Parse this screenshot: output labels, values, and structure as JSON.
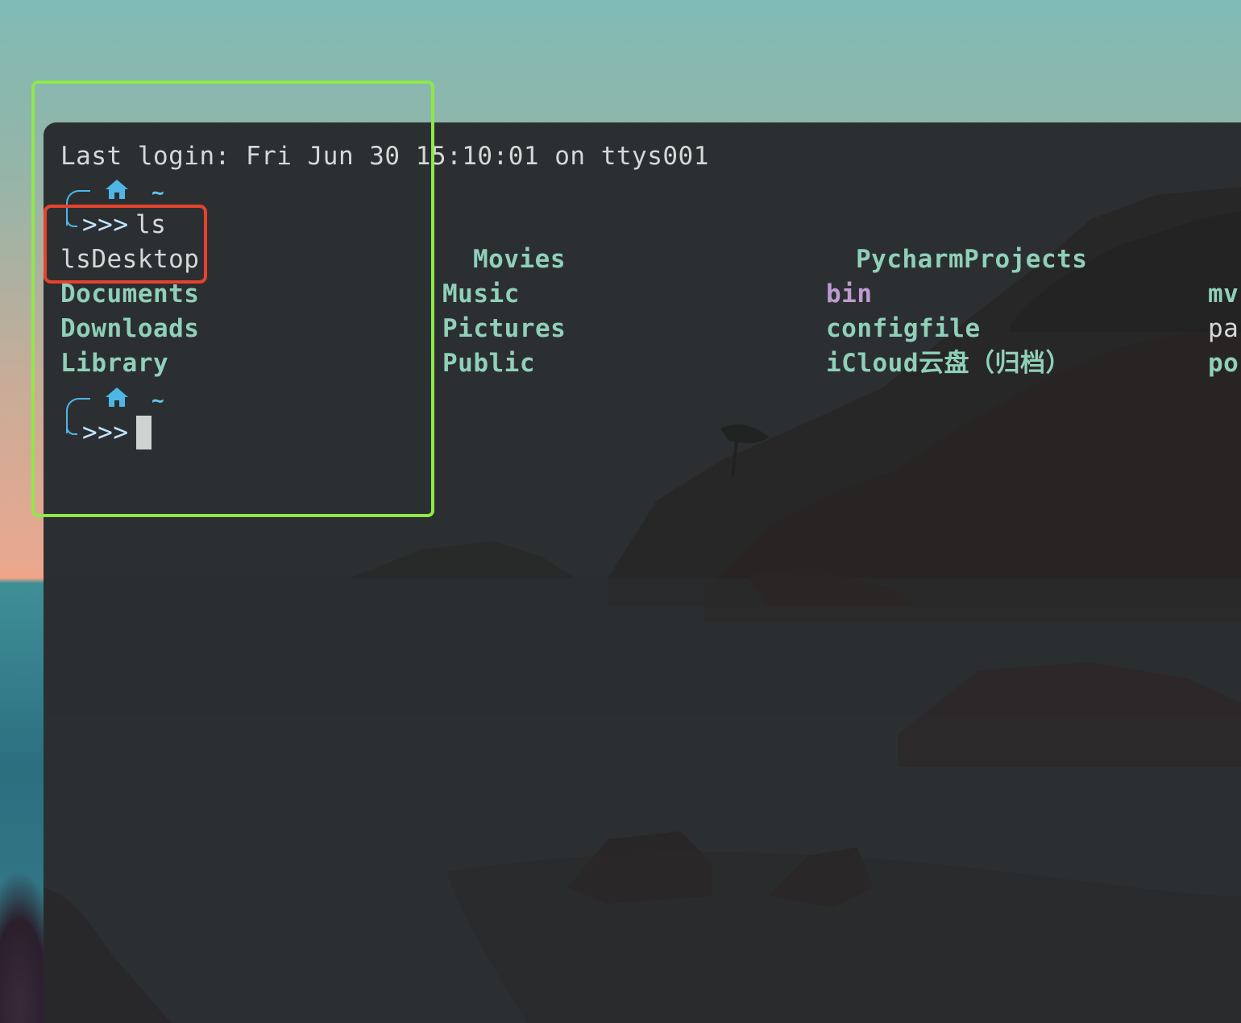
{
  "terminal": {
    "login_line": "Last login: Fri Jun 30 15:10:01 on ttys001",
    "prompt1": {
      "home_icon": "house-icon",
      "tilde": "~",
      "arrows": ">>>",
      "command": "ls"
    },
    "listing": {
      "col1": [
        "lsDesktop",
        "Documents",
        "Downloads",
        "Library"
      ],
      "col2": [
        "Movies",
        "Music",
        "Pictures",
        "Public"
      ],
      "col3": [
        "PycharmProjects",
        "bin",
        "configfile",
        "iCloud云盘（归档）"
      ],
      "col4": [
        "mv",
        "pa",
        "po"
      ]
    },
    "prompt2": {
      "home_icon": "house-icon",
      "tilde": "~",
      "arrows": ">>>"
    }
  },
  "colors": {
    "directory_text": "#8fd0b8",
    "executable_text": "#c09bd2",
    "terminal_bg": "#2c2f31",
    "highlight_green": "#8fe84a",
    "highlight_red": "#e5432c"
  }
}
